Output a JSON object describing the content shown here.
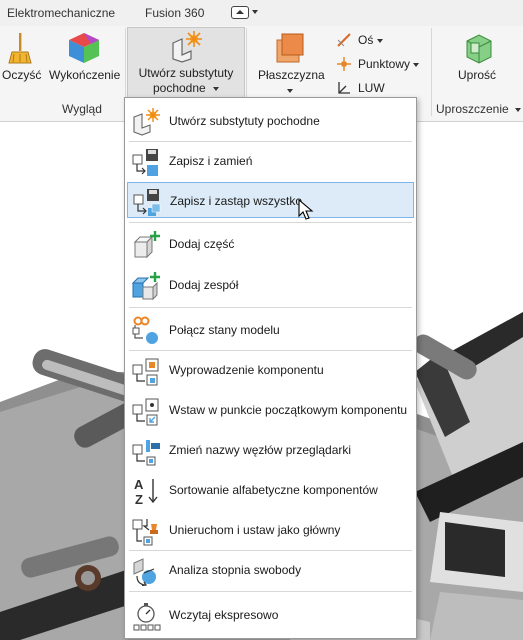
{
  "tabs": {
    "items": [
      "Elektromechaniczne",
      "Fusion 360"
    ]
  },
  "ribbon": {
    "clean_label": "Oczyść",
    "finish_label": "Wykończenie",
    "appearance_group": "Wygląd",
    "derived_label": "Utwórz substytuty pochodne",
    "derived_line1": "Utwórz substytuty",
    "derived_line2": "pochodne",
    "plane_label": "Płaszczyzna",
    "axis_label": "Oś",
    "point_label": "Punktowy",
    "ucs_label": "LUW",
    "simplify_label": "Uprość",
    "simplify_group": "Uproszczenie"
  },
  "menu": {
    "items": [
      {
        "label": "Utwórz substytuty pochodne",
        "icon": "derived-substitute-icon"
      },
      {
        "label": "Zapisz i zamień",
        "icon": "save-replace-icon"
      },
      {
        "label": "Zapisz i zastąp wszystko",
        "icon": "save-replace-all-icon"
      },
      {
        "label": "Dodaj część",
        "icon": "add-part-icon"
      },
      {
        "label": "Dodaj zespół",
        "icon": "add-assembly-icon"
      },
      {
        "label": "Połącz stany modelu",
        "icon": "merge-model-states-icon"
      },
      {
        "label": "Wyprowadzenie komponentu",
        "icon": "component-derive-icon"
      },
      {
        "label": "Wstaw w punkcie początkowym komponentu",
        "icon": "insert-origin-icon"
      },
      {
        "label": "Zmień nazwy węzłów przeglądarki",
        "icon": "rename-nodes-icon"
      },
      {
        "label": "Sortowanie alfabetyczne komponentów",
        "icon": "sort-az-icon"
      },
      {
        "label": "Unieruchom i ustaw jako główny",
        "icon": "ground-root-icon"
      },
      {
        "label": "Analiza stopnia swobody",
        "icon": "dof-analysis-icon"
      },
      {
        "label": "Wczytaj ekspresowo",
        "icon": "express-load-icon"
      }
    ],
    "highlighted_index": 2
  }
}
